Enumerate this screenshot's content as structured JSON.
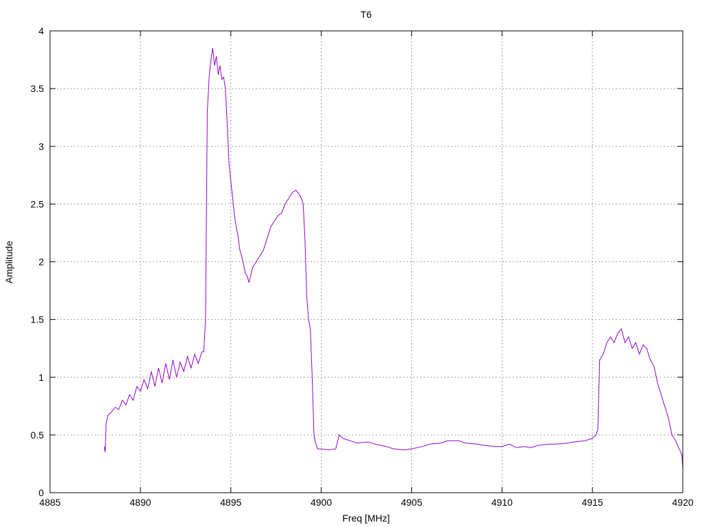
{
  "chart_data": {
    "type": "line",
    "title": "T6",
    "xlabel": "Freq [MHz]",
    "ylabel": "Amplitude",
    "xlim": [
      4885,
      4920
    ],
    "ylim": [
      0,
      4
    ],
    "x_ticks": [
      4885,
      4890,
      4895,
      4900,
      4905,
      4910,
      4915,
      4920
    ],
    "y_ticks": [
      0,
      0.5,
      1,
      1.5,
      2,
      2.5,
      3,
      3.5,
      4
    ],
    "x_tick_labels": [
      "4885",
      "4890",
      "4895",
      "4900",
      "4905",
      "4910",
      "4915",
      "4920"
    ],
    "y_tick_labels": [
      "0",
      "0.5",
      "1",
      "1.5",
      "2",
      "2.5",
      "3",
      "3.5",
      "4"
    ],
    "grid": true,
    "legend": "none",
    "colors": {
      "series": "#9400d3",
      "grid": "#a0a0a0",
      "axis": "#000000"
    },
    "series": [
      {
        "x": [
          4888.0,
          4888.05,
          4888.1,
          4888.2,
          4888.4,
          4888.6,
          4888.8,
          4889.0,
          4889.2,
          4889.4,
          4889.6,
          4889.8,
          4890.0,
          4890.2,
          4890.4,
          4890.6,
          4890.8,
          4891.0,
          4891.2,
          4891.4,
          4891.6,
          4891.8,
          4892.0,
          4892.2,
          4892.4,
          4892.6,
          4892.8,
          4893.0,
          4893.2,
          4893.4,
          4893.5,
          4893.6,
          4893.7,
          4893.8,
          4893.9,
          4894.0,
          4894.1,
          4894.2,
          4894.3,
          4894.4,
          4894.5,
          4894.6,
          4894.7,
          4894.8,
          4894.9,
          4895.0,
          4895.1,
          4895.2,
          4895.3,
          4895.4,
          4895.5,
          4895.6,
          4895.7,
          4895.8,
          4895.9,
          4896.0,
          4896.2,
          4896.4,
          4896.6,
          4896.8,
          4897.0,
          4897.2,
          4897.4,
          4897.6,
          4897.8,
          4898.0,
          4898.2,
          4898.4,
          4898.6,
          4898.8,
          4898.9,
          4899.0,
          4899.1,
          4899.2,
          4899.3,
          4899.4,
          4899.5,
          4899.6,
          4899.7,
          4899.8,
          4900.0,
          4900.4,
          4900.8,
          4901.0,
          4901.2,
          4901.6,
          4902.0,
          4902.6,
          4903.0,
          4903.6,
          4904.0,
          4904.6,
          4905.0,
          4905.6,
          4906.0,
          4906.6,
          4907.0,
          4907.6,
          4908.0,
          4908.6,
          4909.0,
          4909.6,
          4910.0,
          4910.4,
          4910.8,
          4911.2,
          4911.6,
          4912.0,
          4912.6,
          4913.0,
          4913.6,
          4914.0,
          4914.6,
          4915.0,
          4915.2,
          4915.3,
          4915.4,
          4915.6,
          4915.8,
          4916.0,
          4916.2,
          4916.4,
          4916.6,
          4916.8,
          4917.0,
          4917.2,
          4917.4,
          4917.6,
          4917.8,
          4918.0,
          4918.2,
          4918.4,
          4918.6,
          4918.8,
          4919.0,
          4919.2,
          4919.4,
          4919.6,
          4919.8,
          4919.95,
          4920.0
        ],
        "y": [
          0.4,
          0.35,
          0.6,
          0.67,
          0.7,
          0.74,
          0.72,
          0.8,
          0.76,
          0.85,
          0.8,
          0.92,
          0.88,
          0.98,
          0.9,
          1.05,
          0.92,
          1.08,
          0.95,
          1.12,
          0.98,
          1.15,
          1.0,
          1.13,
          1.05,
          1.18,
          1.08,
          1.2,
          1.12,
          1.22,
          1.22,
          1.5,
          3.3,
          3.6,
          3.75,
          3.85,
          3.7,
          3.78,
          3.62,
          3.7,
          3.58,
          3.6,
          3.5,
          3.2,
          2.85,
          2.7,
          2.55,
          2.4,
          2.3,
          2.22,
          2.1,
          2.05,
          1.98,
          1.9,
          1.88,
          1.82,
          1.95,
          2.0,
          2.05,
          2.1,
          2.2,
          2.3,
          2.35,
          2.4,
          2.42,
          2.5,
          2.55,
          2.6,
          2.62,
          2.58,
          2.55,
          2.5,
          2.2,
          1.7,
          1.5,
          1.42,
          1.0,
          0.5,
          0.42,
          0.38,
          0.38,
          0.37,
          0.38,
          0.5,
          0.47,
          0.45,
          0.43,
          0.44,
          0.42,
          0.4,
          0.38,
          0.37,
          0.38,
          0.4,
          0.42,
          0.43,
          0.45,
          0.45,
          0.43,
          0.42,
          0.41,
          0.4,
          0.4,
          0.42,
          0.39,
          0.4,
          0.39,
          0.41,
          0.42,
          0.42,
          0.43,
          0.44,
          0.45,
          0.47,
          0.5,
          0.55,
          1.15,
          1.2,
          1.3,
          1.35,
          1.3,
          1.38,
          1.42,
          1.3,
          1.35,
          1.25,
          1.3,
          1.2,
          1.28,
          1.25,
          1.15,
          1.1,
          0.95,
          0.85,
          0.75,
          0.65,
          0.5,
          0.45,
          0.38,
          0.33,
          0.2
        ]
      }
    ]
  }
}
